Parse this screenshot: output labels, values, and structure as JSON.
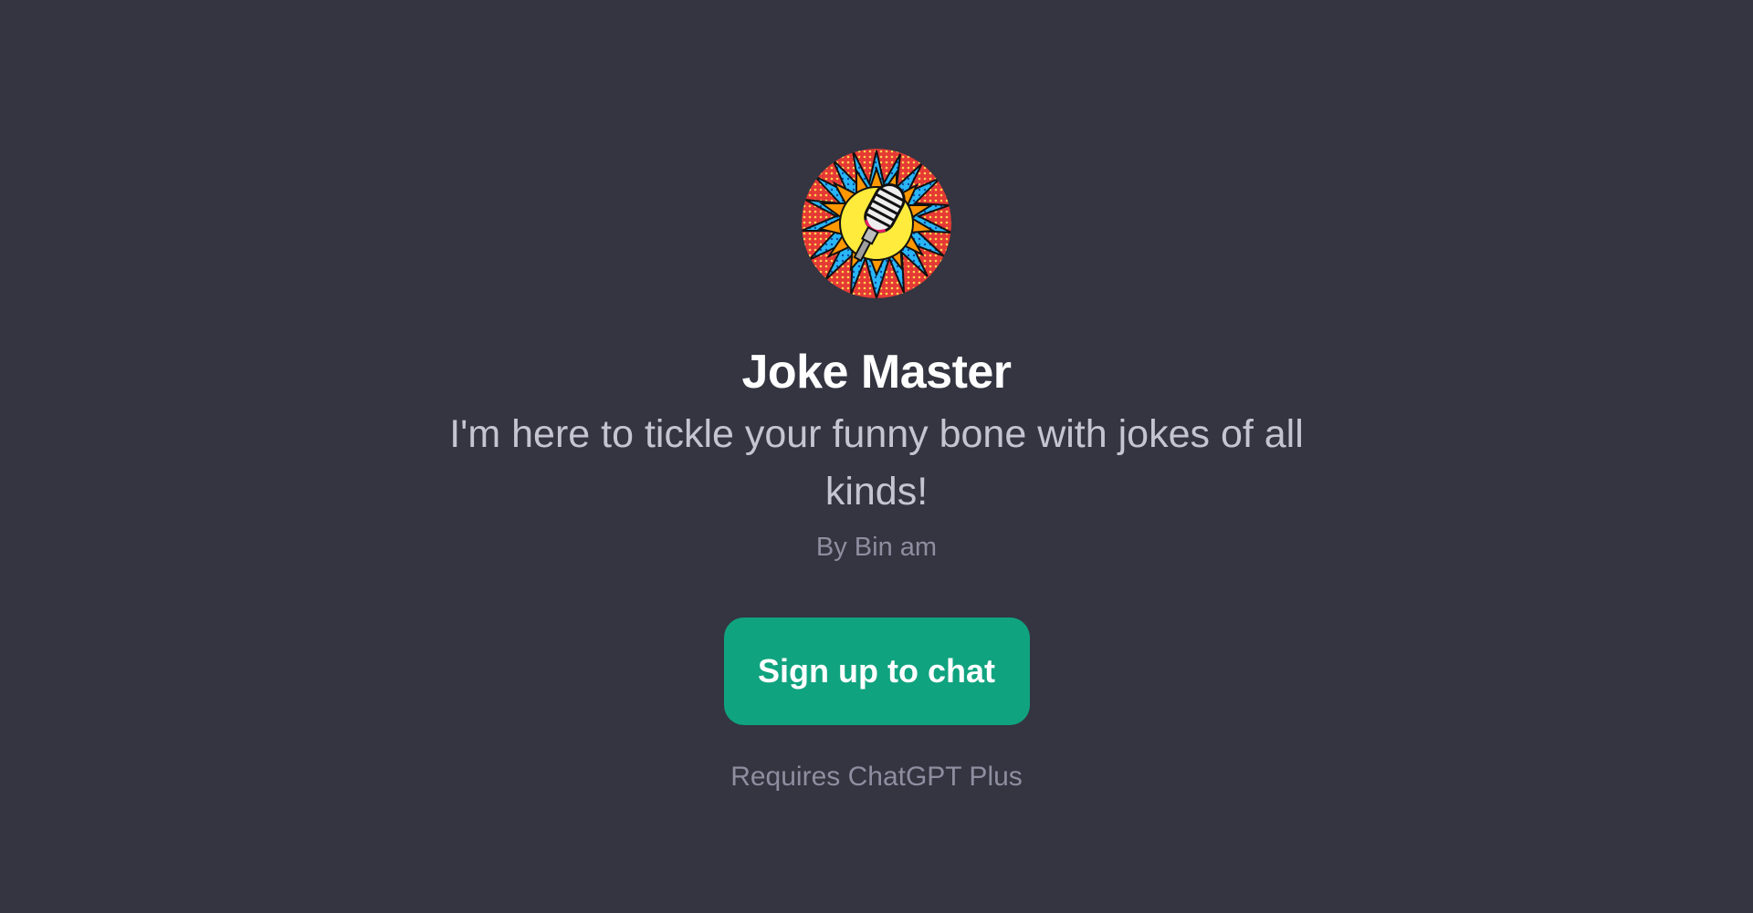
{
  "gpt": {
    "name": "Joke Master",
    "description": "I'm here to tickle your funny bone with jokes of all kinds!",
    "author": "By Bin am",
    "avatar_icon": "microphone-burst-icon"
  },
  "actions": {
    "signup_label": "Sign up to chat",
    "requirement_note": "Requires ChatGPT Plus"
  },
  "colors": {
    "background": "#343541",
    "accent": "#10a37f",
    "title": "#ffffff",
    "description": "#c5c5d2",
    "muted": "#8e8ea0"
  }
}
